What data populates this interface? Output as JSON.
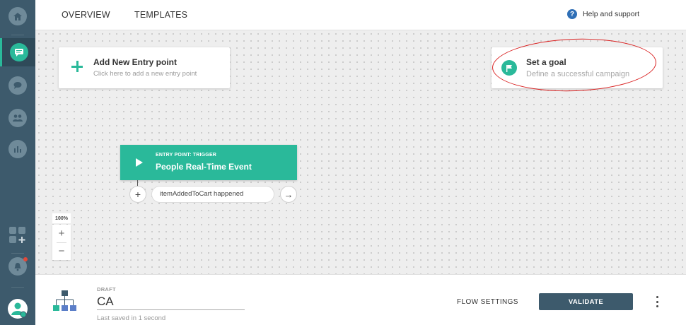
{
  "sidebar": {
    "icons": [
      "home-icon",
      "campaigns-icon",
      "chat-icon",
      "people-icon",
      "analytics-icon",
      "apps-add-icon",
      "notifications-icon",
      "user-profile-icon"
    ]
  },
  "header": {
    "tabs": [
      {
        "label": "OVERVIEW"
      },
      {
        "label": "TEMPLATES"
      }
    ],
    "help_label": "Help and support",
    "help_icon": "?"
  },
  "canvas": {
    "entry_card": {
      "title": "Add New Entry point",
      "subtitle": "Click here to add a new entry point"
    },
    "goal_card": {
      "title": "Set a goal",
      "subtitle": "Define a successful campaign"
    },
    "trigger_node": {
      "label_small": "ENTRY POINT: TRIGGER",
      "title": "People Real-Time Event",
      "event_pill": "itemAddedToCart happened"
    },
    "zoom": {
      "level": "100%",
      "plus": "+",
      "minus": "−"
    },
    "add_symbol": "+",
    "arrow_symbol": "→"
  },
  "footer": {
    "status": "DRAFT",
    "campaign_name": "CA",
    "saved_text": "Last saved in 1 second",
    "flow_settings_label": "FLOW SETTINGS",
    "validate_label": "VALIDATE"
  },
  "colors": {
    "sidebar": "#3d5a6c",
    "accent": "#2ab99a",
    "highlight": "#d91f1f"
  }
}
